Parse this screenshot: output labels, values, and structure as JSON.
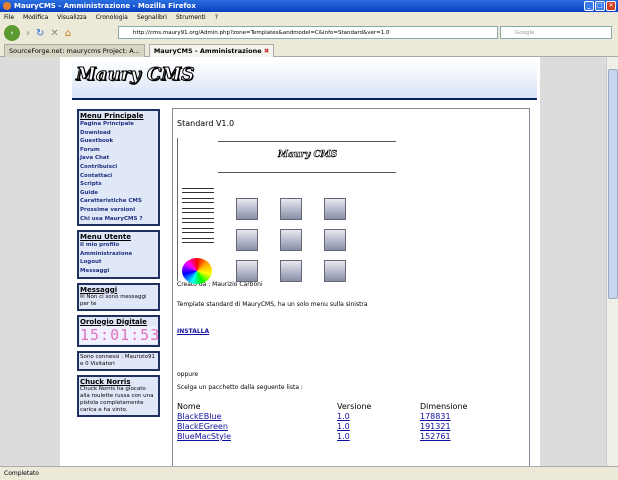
{
  "window": {
    "title": "MauryCMS - Amministrazione - Mozilla Firefox"
  },
  "menu": [
    "File",
    "Modifica",
    "Visualizza",
    "Cronologia",
    "Segnalibri",
    "Strumenti",
    "?"
  ],
  "nav": {
    "url": "http://cms.maury91.org/Admin.php?zone=Templates&andmodel=C&info=Standard&ver=1.0",
    "search_placeholder": "Google"
  },
  "tabs": [
    {
      "label": "SourceForge.net: maurycms Project: A..."
    },
    {
      "label": "MauryCMS - Amministrazione"
    }
  ],
  "site": {
    "logo": "Maury CMS"
  },
  "sidebar": {
    "main_menu": {
      "title": "Menu Principale",
      "items": [
        "Pagina Principale",
        "Download",
        "Guestbook",
        "Forum",
        "Java Chat",
        "Contribuisci",
        "Contattaci",
        "Scripts",
        "Guide",
        "Caratteristiche CMS",
        "Prossime versioni",
        "Chi usa MauryCMS ?"
      ]
    },
    "user_menu": {
      "title": "Menu Utente",
      "items": [
        "Il mio profilo",
        "Amministrazione",
        "Logout",
        "Messaggi"
      ]
    },
    "messages": {
      "title": "Messaggi",
      "text": "Non ci sono messaggi per te"
    },
    "clock": {
      "title": "Orologio Digitale",
      "time": "15:01:53"
    },
    "online": {
      "text": "Sono connessi : Maurizio91 e 0 Visitatori"
    },
    "chuck": {
      "title": "Chuck Norris",
      "text": "Chuck Norris ha giocato alla roulette russa con una pistola completamente carica e ha vinto."
    }
  },
  "main": {
    "title": "Standard V1.0",
    "preview_logo": "Maury CMS",
    "author": "Creato da : Maurizio Carboni",
    "description": "Template standard di MauryCMS, ha un solo menu sulla sinistra",
    "install": "INSTALLA",
    "or": "oppure",
    "choose": "Scelga un pacchetto dalla seguente lista :",
    "table": {
      "headers": [
        "Nome",
        "Versione",
        "Dimensione"
      ],
      "rows": [
        [
          "BlackEBlue",
          "1.0",
          "178831"
        ],
        [
          "BlackEGreen",
          "1.0",
          "191321"
        ],
        [
          "BlueMacStyle",
          "1.0",
          "152761"
        ]
      ]
    }
  },
  "status": "Completato"
}
